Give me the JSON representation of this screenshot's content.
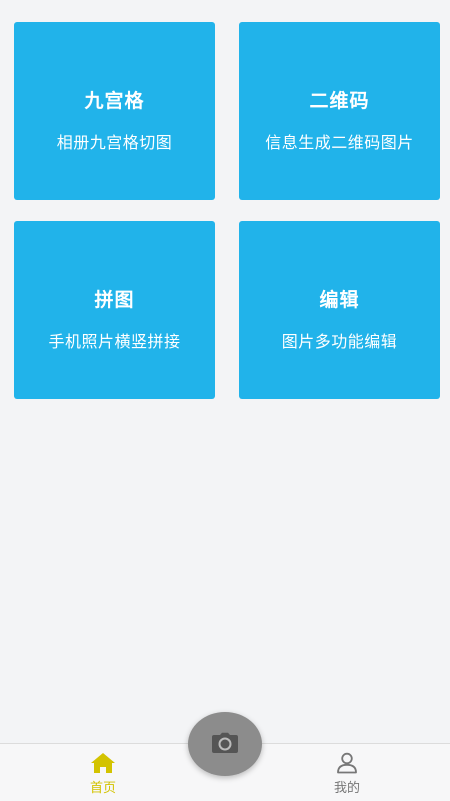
{
  "cards": [
    {
      "title": "九宫格",
      "subtitle": "相册九宫格切图"
    },
    {
      "title": "二维码",
      "subtitle": "信息生成二维码图片"
    },
    {
      "title": "拼图",
      "subtitle": "手机照片横竖拼接"
    },
    {
      "title": "编辑",
      "subtitle": "图片多功能编辑"
    }
  ],
  "tabbar": {
    "home_label": "首页",
    "mine_label": "我的",
    "home_icon": "home-icon",
    "mine_icon": "user-icon",
    "camera_icon": "camera-icon",
    "active_color": "#d3c300"
  },
  "colors": {
    "card_bg": "#21b3ea",
    "page_bg": "#f3f4f6",
    "fab_bg": "#8c8c8c"
  }
}
